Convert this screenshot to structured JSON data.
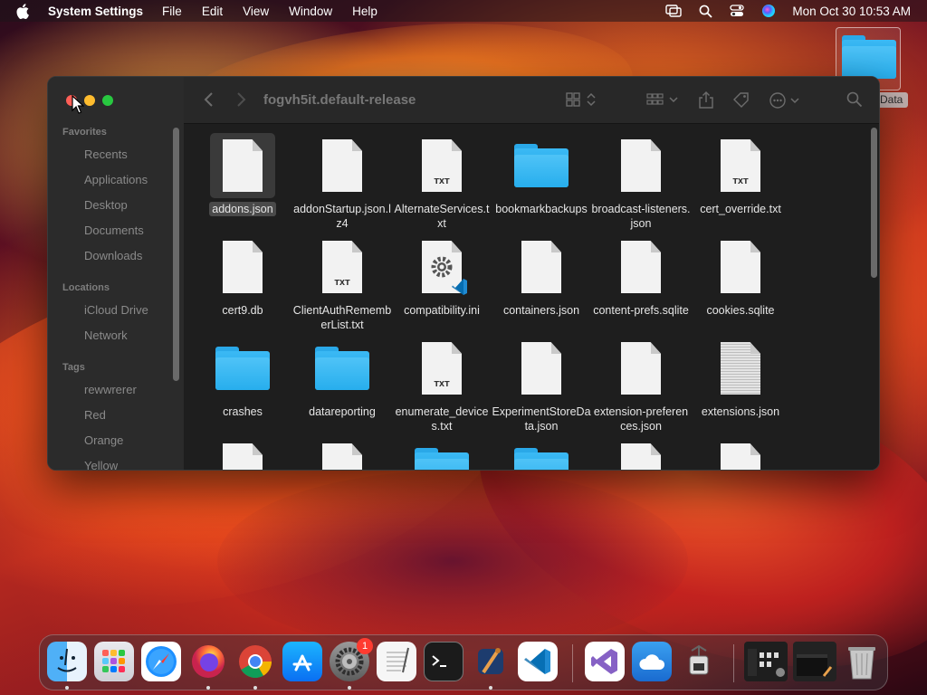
{
  "menubar": {
    "app_name": "System Settings",
    "items": [
      "File",
      "Edit",
      "View",
      "Window",
      "Help"
    ],
    "clock": "Mon Oct 30  10:53 AM"
  },
  "desktop": {
    "folder_label": "Data"
  },
  "finder": {
    "title": "fogvh5it.default-release",
    "sidebar": {
      "favorites_header": "Favorites",
      "favorites": [
        "Recents",
        "Applications",
        "Desktop",
        "Documents",
        "Downloads"
      ],
      "locations_header": "Locations",
      "locations": [
        "iCloud Drive",
        "Network"
      ],
      "tags_header": "Tags",
      "tags": [
        "rewwrerer",
        "Red",
        "Orange",
        "Yellow"
      ]
    },
    "files": [
      {
        "name": "addons.json",
        "kind": "doc",
        "selected": true
      },
      {
        "name": "addonStartup.json.lz4",
        "kind": "doc"
      },
      {
        "name": "AlternateServices.txt",
        "kind": "txt"
      },
      {
        "name": "bookmarkbackups",
        "kind": "folder"
      },
      {
        "name": "broadcast-listeners.json",
        "kind": "doc"
      },
      {
        "name": "cert_override.txt",
        "kind": "txt"
      },
      {
        "name": "cert9.db",
        "kind": "doc"
      },
      {
        "name": "ClientAuthRememberList.txt",
        "kind": "txt"
      },
      {
        "name": "compatibility.ini",
        "kind": "ini"
      },
      {
        "name": "containers.json",
        "kind": "doc"
      },
      {
        "name": "content-prefs.sqlite",
        "kind": "doc"
      },
      {
        "name": "cookies.sqlite",
        "kind": "doc"
      },
      {
        "name": "crashes",
        "kind": "folder"
      },
      {
        "name": "datareporting",
        "kind": "folder"
      },
      {
        "name": "enumerate_devices.txt",
        "kind": "txt"
      },
      {
        "name": "ExperimentStoreData.json",
        "kind": "doc"
      },
      {
        "name": "extension-preferences.json",
        "kind": "doc"
      },
      {
        "name": "extensions.json",
        "kind": "preview"
      }
    ],
    "txt_tag": "TXT"
  },
  "dock": {
    "apps": [
      "Finder",
      "Launchpad",
      "Safari",
      "Firefox",
      "Chrome",
      "App Store",
      "System Settings",
      "TextEdit",
      "Terminal",
      "Xcode",
      "Visual Studio Code",
      "Visual Studio",
      "Weather",
      "Automator",
      "Window Preview",
      "Window Preview 2",
      "Trash"
    ],
    "settings_badge": "1"
  }
}
